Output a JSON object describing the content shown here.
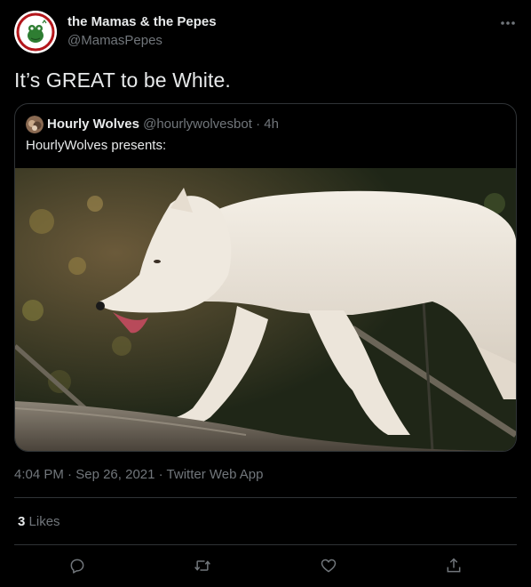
{
  "author": {
    "name": "the Mamas & the Pepes",
    "handle": "@MamasPepes",
    "avatar_icon": "frog-avatar-icon"
  },
  "tweet": {
    "text": "It’s GREAT to be White."
  },
  "quoted": {
    "name": "Hourly Wolves",
    "handle": "@hourlywolvesbot",
    "separator": "·",
    "time": "4h",
    "text": "HourlyWolves presents:",
    "media_icon": "wolf-photo"
  },
  "meta": {
    "time": "4:04 PM",
    "sep1": "·",
    "date": "Sep 26, 2021",
    "sep2": "·",
    "source": "Twitter Web App"
  },
  "stats": {
    "likes_count": "3",
    "likes_label": "Likes"
  },
  "actions": [
    {
      "icon": "reply-icon"
    },
    {
      "icon": "retweet-icon"
    },
    {
      "icon": "like-icon"
    },
    {
      "icon": "share-icon"
    }
  ],
  "colors": {
    "background": "#000000",
    "text": "#e7e9ea",
    "secondary": "#71767b",
    "border": "#2f3336"
  }
}
